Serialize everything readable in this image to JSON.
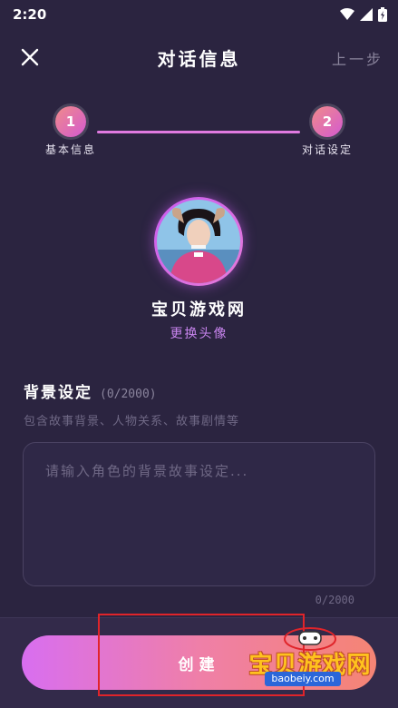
{
  "status_bar": {
    "time": "2:20"
  },
  "header": {
    "title": "对话信息",
    "prev_label": "上一步"
  },
  "stepper": {
    "steps": [
      {
        "number": "1",
        "label": "基本信息"
      },
      {
        "number": "2",
        "label": "对话设定"
      }
    ]
  },
  "profile": {
    "name": "宝贝游戏网",
    "change_avatar_label": "更换头像"
  },
  "background": {
    "title": "背景设定",
    "count": "(0/2000)",
    "description": "包含故事背景、人物关系、故事剧情等",
    "placeholder": "请输入角色的背景故事设定...",
    "value": "",
    "counter": "0/2000"
  },
  "actions": {
    "create_label": "创建"
  },
  "watermark": {
    "text": "宝贝游戏网",
    "url": "baobeiy.com"
  },
  "colors": {
    "background": "#2b2440",
    "accent": "#c985ef",
    "gradient_start": "#d86ef0",
    "gradient_end": "#f58474"
  }
}
